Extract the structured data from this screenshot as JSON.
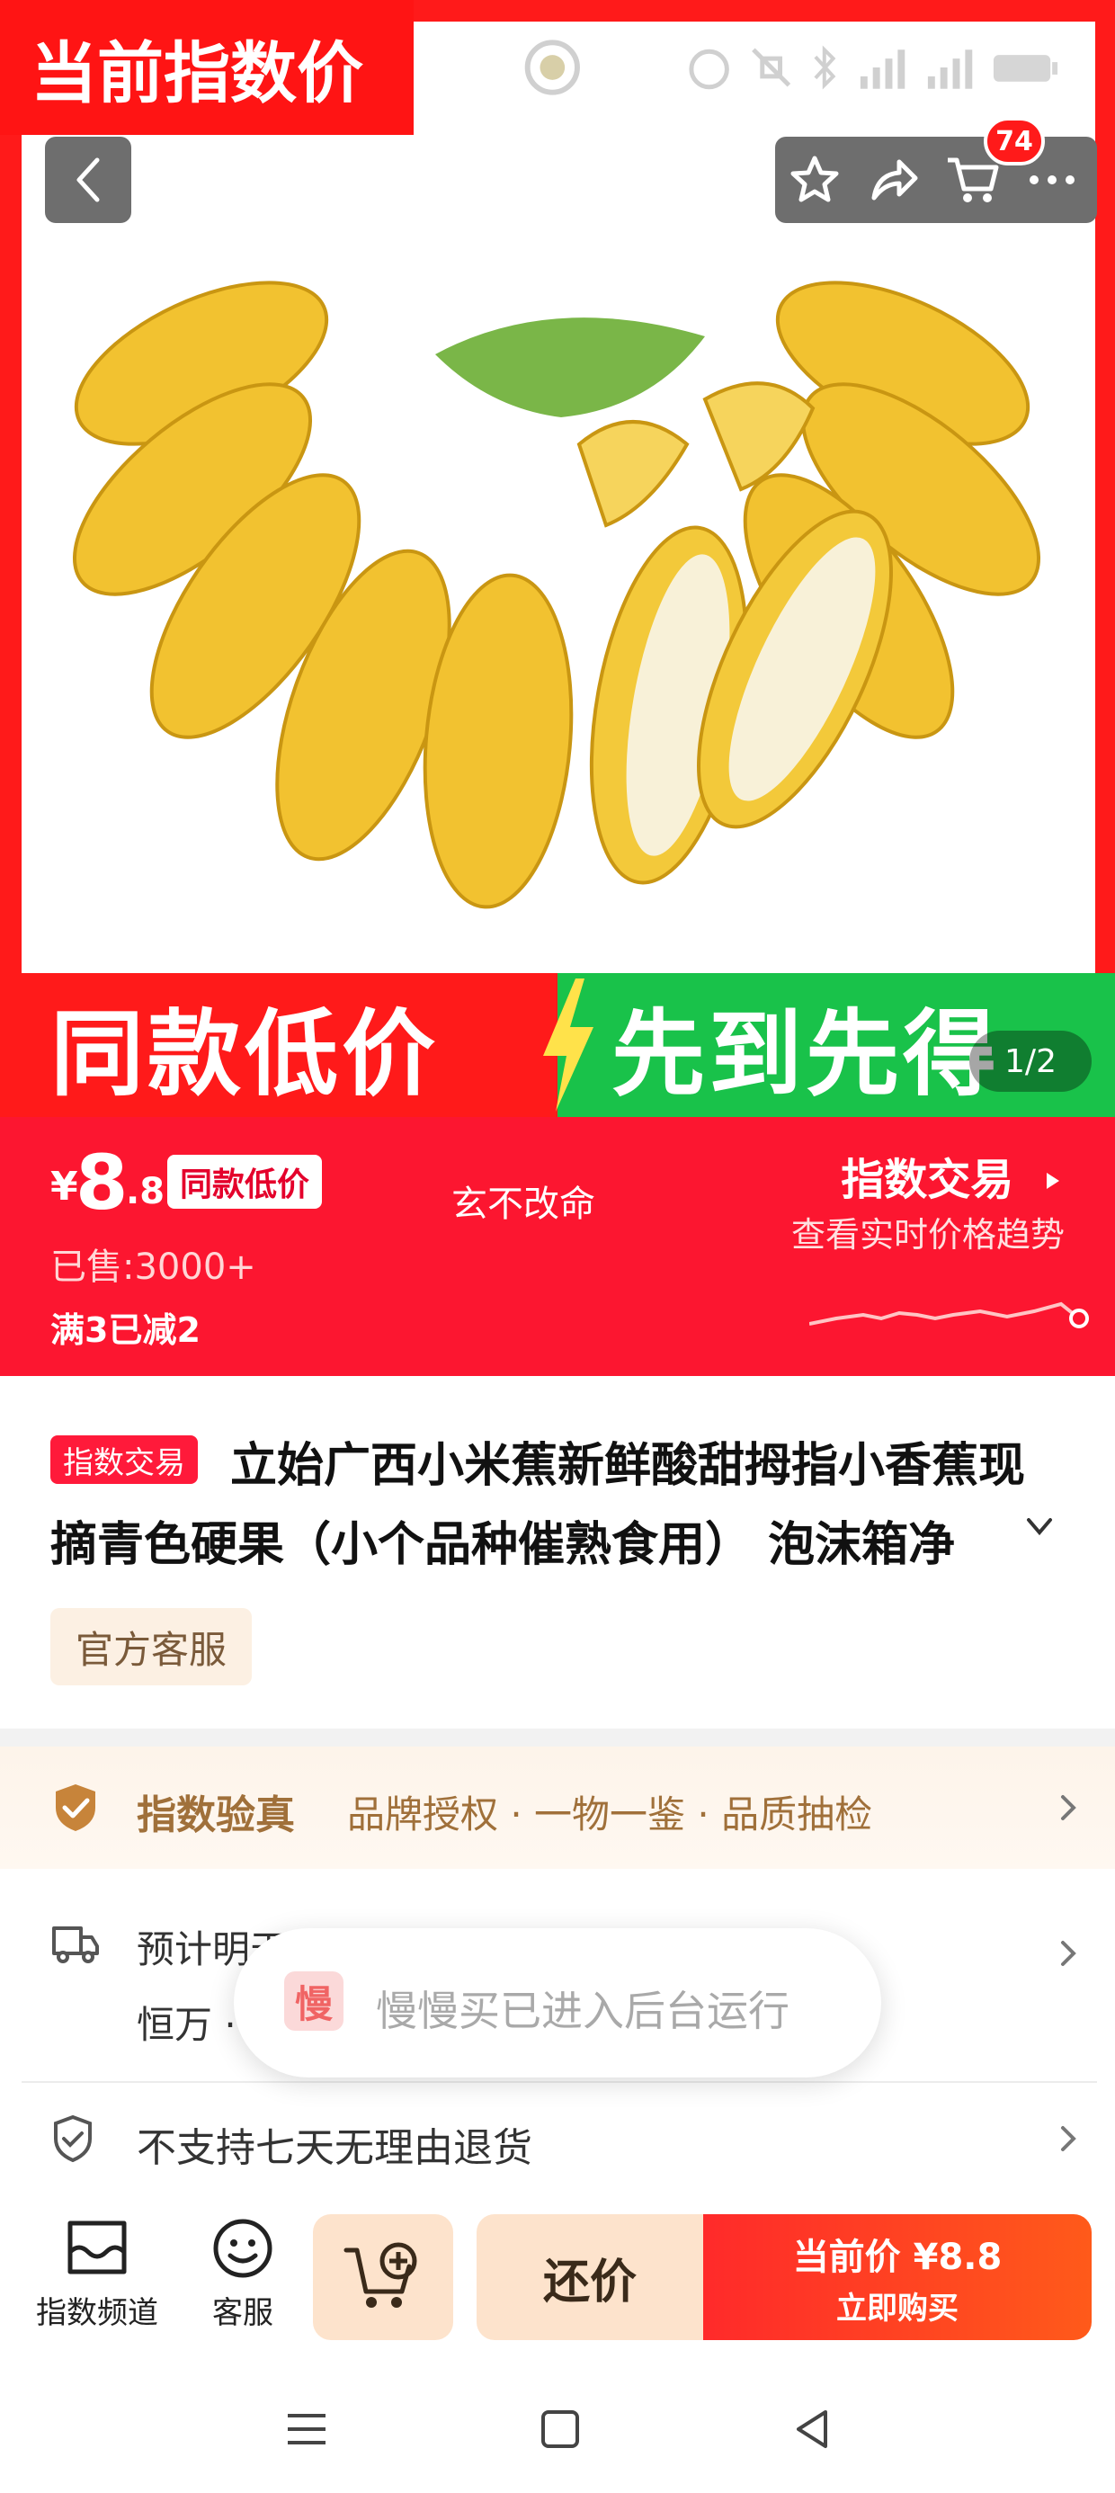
{
  "hero": {
    "promo_tag": "当前指数价",
    "banner_left": "同款低价",
    "banner_right": "先到先得",
    "image_index": "1/2",
    "cart_count": "74"
  },
  "price": {
    "currency": "¥",
    "integer": "8",
    "decimal": ".8",
    "low_price_badge": "同款低价",
    "seller": "玄不改命",
    "sold": "已售:3000+",
    "discount": "满3已减2",
    "trade_title": "指数交易",
    "trade_sub": "查看实时价格趋势"
  },
  "product": {
    "badge": "指数交易",
    "title": "立始广西小米蕉新鲜酸甜拇指小香蕉现摘青色硬果（小个品种催熟食用） 泡沫箱净",
    "service_tag": "官方客服"
  },
  "verify": {
    "title": "指数验真",
    "text": "品牌授权 · 一物一鉴 · 品质抽检"
  },
  "shipping": {
    "line1": "预计明天发货 · 3月3日(周二)送达",
    "line2": "恒万 · 免运费"
  },
  "toast": {
    "icon_char": "慢",
    "text": "慢慢买已进入后台运行"
  },
  "returns": {
    "text": "不支持七天无理由退货"
  },
  "bottom": {
    "channel_label": "指数频道",
    "service_label": "客服",
    "bargain_label": "还价",
    "buy_price": "当前价 ¥8.8",
    "buy_label": "立即购买"
  },
  "colors": {
    "brand_red": "#fc1630",
    "accent_green": "#19c24a",
    "gold_text": "#a0703a"
  }
}
